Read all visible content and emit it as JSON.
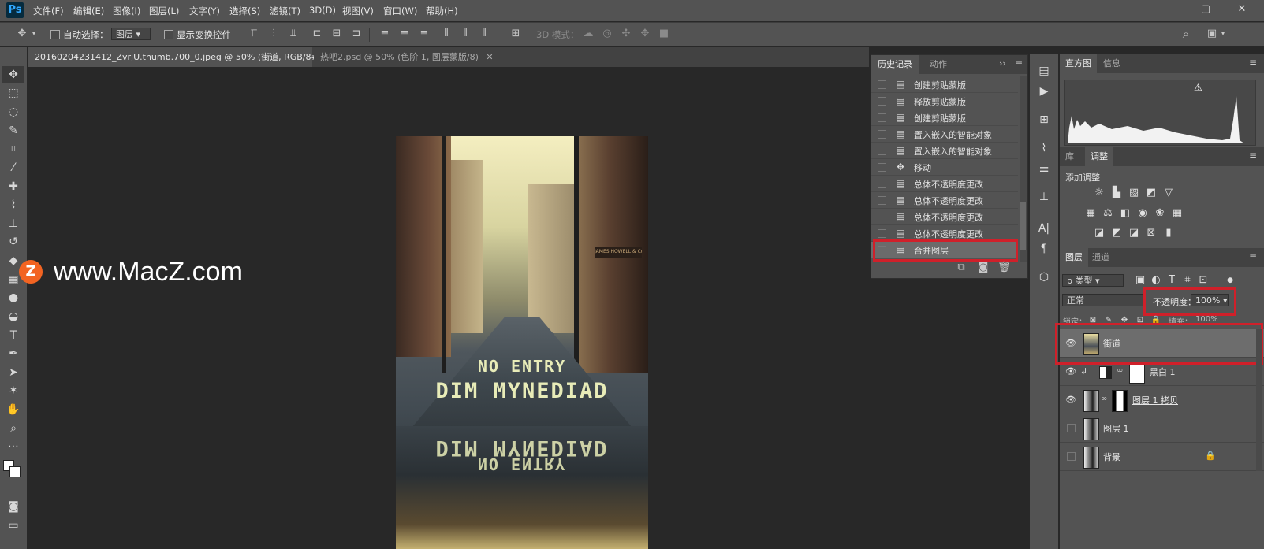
{
  "app": {
    "logo": "Ps"
  },
  "menu": [
    "文件(F)",
    "编辑(E)",
    "图像(I)",
    "图层(L)",
    "文字(Y)",
    "选择(S)",
    "滤镜(T)",
    "3D(D)",
    "视图(V)",
    "窗口(W)",
    "帮助(H)"
  ],
  "window_controls": [
    "—",
    "▢",
    "✕"
  ],
  "options": {
    "auto_select_label": "自动选择：",
    "auto_select_value": "图层",
    "show_transform_label": "显示变换控件",
    "mode3d_label": "3D 模式："
  },
  "tabs": [
    {
      "label": "20160204231412_ZvrjU.thumb.700_0.jpeg @ 50% (街道, RGB/8#) *",
      "close": "✕"
    },
    {
      "label": "热吧2.psd @ 50% (色阶 1, 图层蒙版/8)",
      "close": "✕"
    }
  ],
  "canvas": {
    "road_text_1": "NO ENTRY",
    "road_text_2": "DIM MYNEDIAD",
    "mirror_text_1": "DIM MYNEDIAD",
    "mirror_text_2": "NO ENTRY",
    "sign_text": "JAMES HOWELL & Co",
    "watermark_logo": "Z",
    "watermark_text": "www.MacZ.com"
  },
  "history_panel": {
    "tab_active": "历史记录",
    "tab_other": "动作",
    "items": [
      {
        "label": "创建剪贴蒙版",
        "icon": "document-icon"
      },
      {
        "label": "释放剪贴蒙版",
        "icon": "document-icon"
      },
      {
        "label": "创建剪贴蒙版",
        "icon": "document-icon"
      },
      {
        "label": "置入嵌入的智能对象",
        "icon": "document-icon"
      },
      {
        "label": "置入嵌入的智能对象",
        "icon": "document-icon"
      },
      {
        "label": "移动",
        "icon": "move-icon"
      },
      {
        "label": "总体不透明度更改",
        "icon": "document-icon"
      },
      {
        "label": "总体不透明度更改",
        "icon": "document-icon"
      },
      {
        "label": "总体不透明度更改",
        "icon": "document-icon"
      },
      {
        "label": "总体不透明度更改",
        "icon": "document-icon"
      },
      {
        "label": "合并图层",
        "icon": "document-icon",
        "selected": true
      }
    ]
  },
  "histogram_panel": {
    "tab_active": "直方图",
    "tab_other": "信息",
    "warning": "⚠"
  },
  "adjust_panel": {
    "tab_lib": "库",
    "tab_active": "调整",
    "add_label": "添加调整"
  },
  "layers_panel": {
    "tab_active": "图层",
    "tab_other": "通道",
    "filter_label": "ρ 类型",
    "blend_mode": "正常",
    "opacity_label": "不透明度：",
    "opacity_value": "100%",
    "lock_label": "锁定：",
    "fill_label": "填充：",
    "fill_value": "100%",
    "layers": [
      {
        "name": "街道",
        "visible": true,
        "selected": true
      },
      {
        "name": "黑白 1",
        "visible": true,
        "clipped": true
      },
      {
        "name": "图层 1 拷贝",
        "visible": true
      },
      {
        "name": "图层 1",
        "visible": false
      },
      {
        "name": "背景",
        "visible": false,
        "locked": true
      }
    ]
  },
  "colors": {
    "accent_red": "#d0202a",
    "panel_bg": "#535353",
    "canvas_bg": "#282828"
  }
}
